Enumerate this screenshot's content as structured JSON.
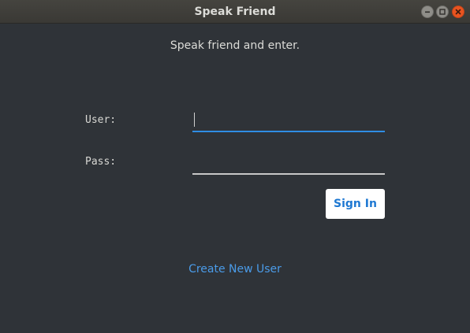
{
  "window": {
    "title": "Speak Friend",
    "controls": {
      "minimize_icon": "minimize-icon",
      "maximize_icon": "maximize-icon",
      "close_icon": "close-icon"
    }
  },
  "login": {
    "prompt": "Speak friend and enter.",
    "user_label": "User:",
    "pass_label": "Pass:",
    "user_value": "",
    "pass_value": "",
    "sign_in_label": "Sign In",
    "create_user_label": "Create New User"
  },
  "colors": {
    "background": "#2f3338",
    "accent": "#2f8de4",
    "link": "#4a9be8",
    "close_button": "#e95420"
  }
}
